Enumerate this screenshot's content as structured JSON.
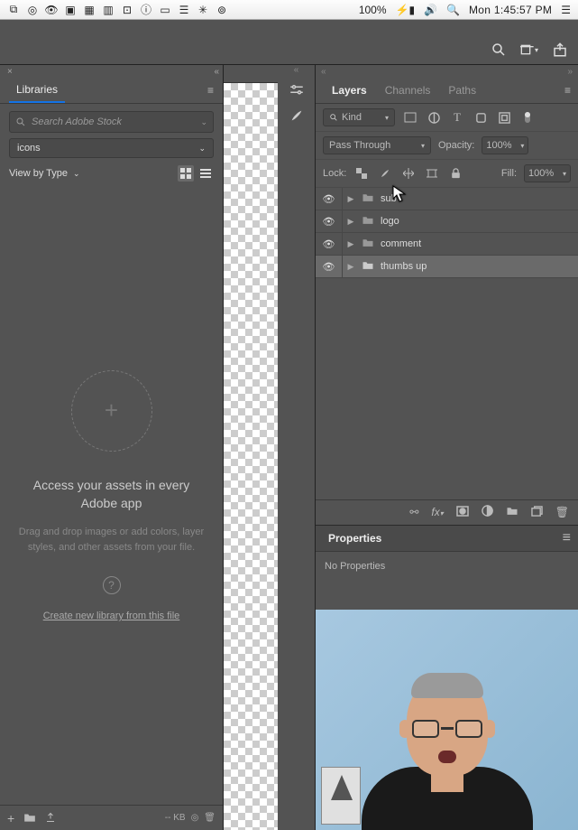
{
  "menubar": {
    "battery": "100%",
    "clock": "Mon 1:45:57 PM"
  },
  "libraries": {
    "tab": "Libraries",
    "search_placeholder": "Search Adobe Stock",
    "collection": "icons",
    "view_by": "View by Type",
    "headline": "Access your assets in every Adobe app",
    "desc": "Drag and drop images or add colors, layer styles, and other assets from your file.",
    "link": "Create new library from this file",
    "size": "-- KB"
  },
  "layers_panel": {
    "tabs": {
      "layers": "Layers",
      "channels": "Channels",
      "paths": "Paths"
    },
    "kind_label": "Kind",
    "blend_mode": "Pass Through",
    "opacity_label": "Opacity:",
    "opacity_val": "100%",
    "lock_label": "Lock:",
    "fill_label": "Fill:",
    "fill_val": "100%",
    "items": [
      {
        "name": "sub"
      },
      {
        "name": "logo"
      },
      {
        "name": "comment"
      },
      {
        "name": "thumbs up"
      }
    ]
  },
  "properties": {
    "tab": "Properties",
    "empty": "No Properties"
  }
}
